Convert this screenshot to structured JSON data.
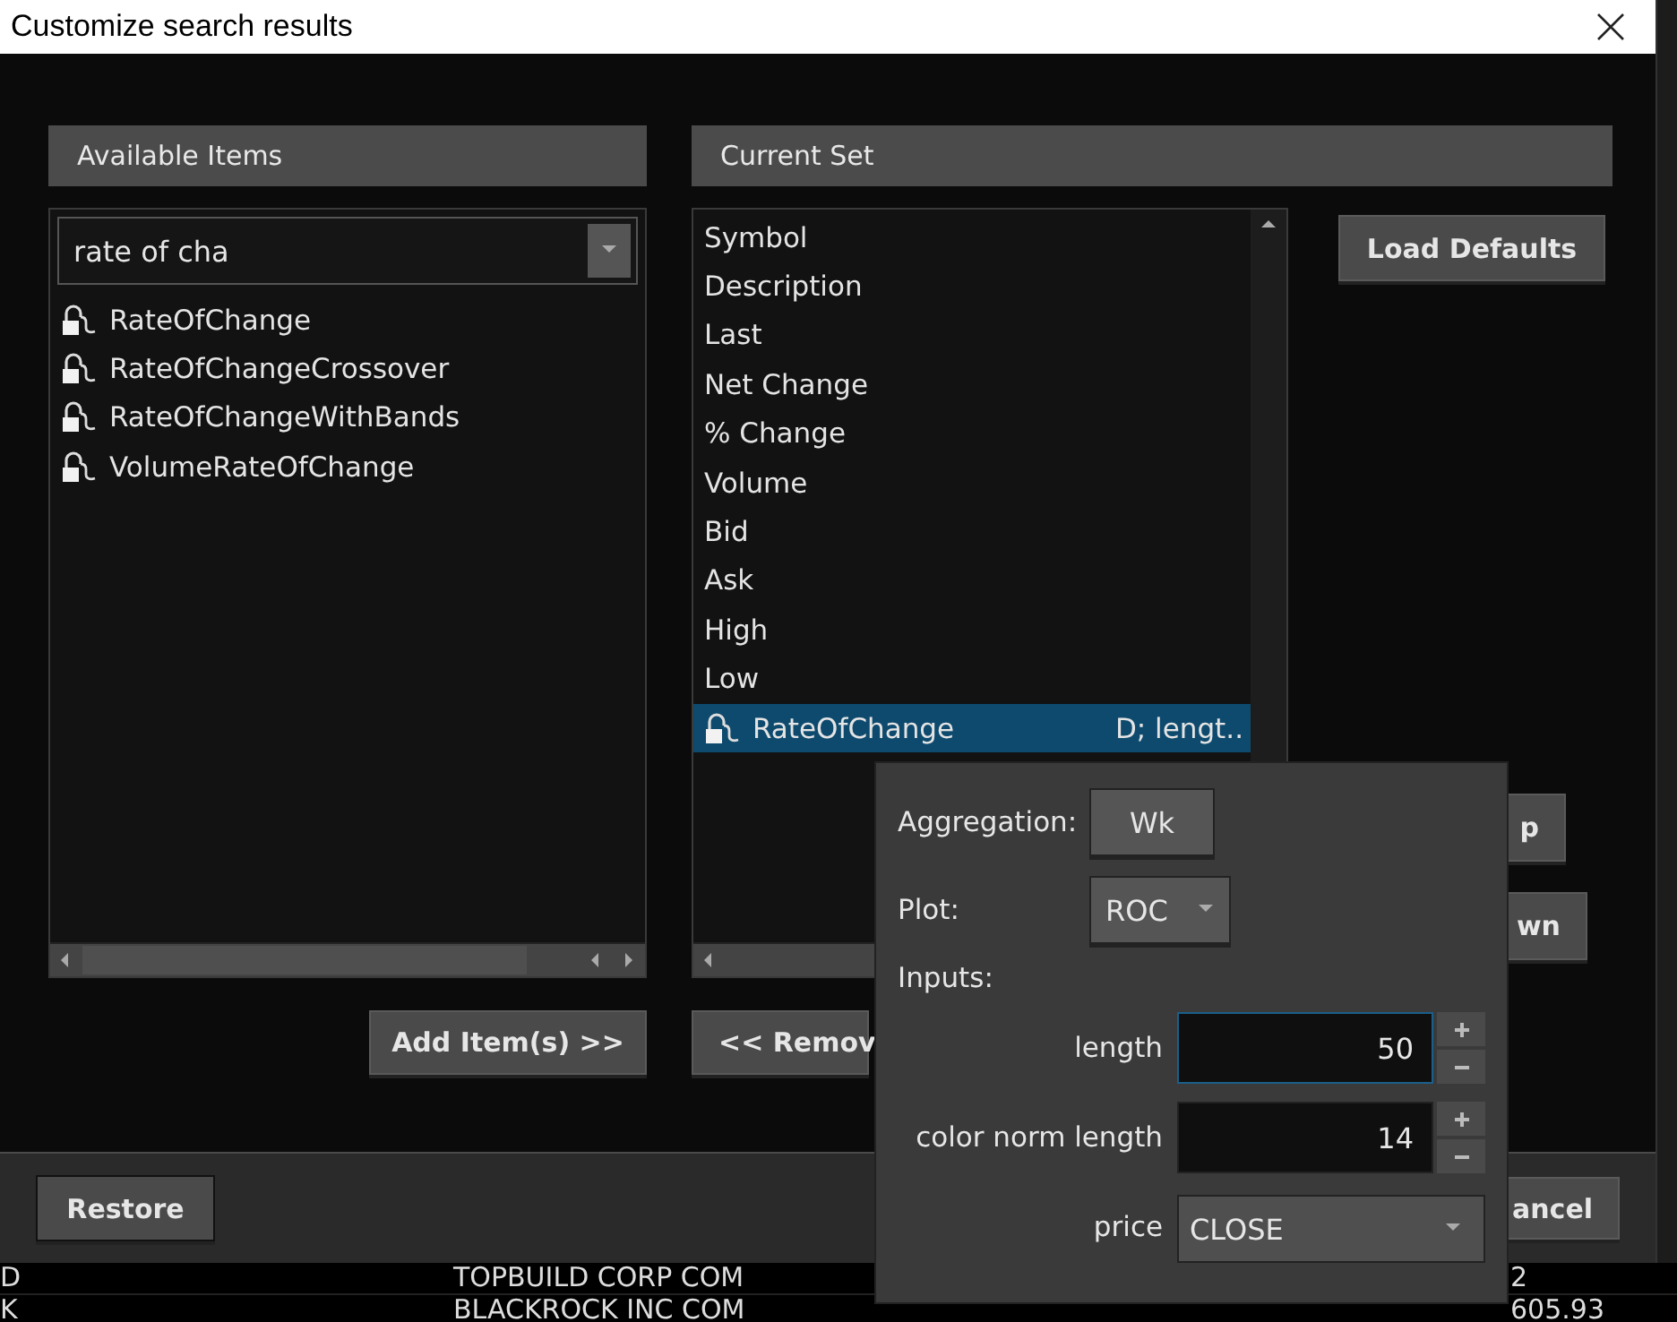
{
  "window": {
    "title": "Customize search results"
  },
  "available_items": {
    "header": "Available Items",
    "search": {
      "value": "rate of cha"
    },
    "items": [
      {
        "label": "RateOfChange",
        "selected": false
      },
      {
        "label": "RateOfChangeCrossover",
        "selected": false
      },
      {
        "label": "RateOfChangeWithBands",
        "selected": false
      },
      {
        "label": "VolumeRateOfChange",
        "selected": false
      }
    ]
  },
  "current_set": {
    "header": "Current Set",
    "items": [
      {
        "kind": "field",
        "label": "Symbol",
        "selected": false
      },
      {
        "kind": "field",
        "label": "Description",
        "selected": false
      },
      {
        "kind": "field",
        "label": "Last",
        "selected": false
      },
      {
        "kind": "field",
        "label": "Net Change",
        "selected": false
      },
      {
        "kind": "field",
        "label": "% Change",
        "selected": false
      },
      {
        "kind": "field",
        "label": "Volume",
        "selected": false
      },
      {
        "kind": "field",
        "label": "Bid",
        "selected": false
      },
      {
        "kind": "field",
        "label": "Ask",
        "selected": false
      },
      {
        "kind": "field",
        "label": "High",
        "selected": false
      },
      {
        "kind": "field",
        "label": "Low",
        "selected": false
      },
      {
        "kind": "study",
        "label": "RateOfChange",
        "detail": "D; lengt..",
        "selected": true
      }
    ]
  },
  "add_button": "Add Item(s) >>",
  "remove_button": "<< Remov",
  "side_buttons": {
    "load_defaults": "Load Defaults",
    "up": "p",
    "down": "wn"
  },
  "footer": {
    "restore": "Restore",
    "cancel": "ancel"
  },
  "popup": {
    "aggregation_label": "Aggregation:",
    "aggregation": "Wk",
    "plot_label": "Plot:",
    "plot": "ROC",
    "inputs_label": "Inputs:",
    "inputs": [
      {
        "kind": "number",
        "label": "length",
        "value": "50",
        "focused": true
      },
      {
        "kind": "number",
        "label": "color norm length",
        "value": "14",
        "focused": false
      },
      {
        "kind": "select",
        "label": "price",
        "value": "CLOSE"
      }
    ]
  },
  "background_table": {
    "rows": [
      {
        "column_1": "D",
        "column_2": "TOPBUILD CORP COM",
        "column_3": "2"
      },
      {
        "column_1": "K",
        "column_2": "BLACKROCK INC COM",
        "column_3": "605.93"
      }
    ]
  }
}
